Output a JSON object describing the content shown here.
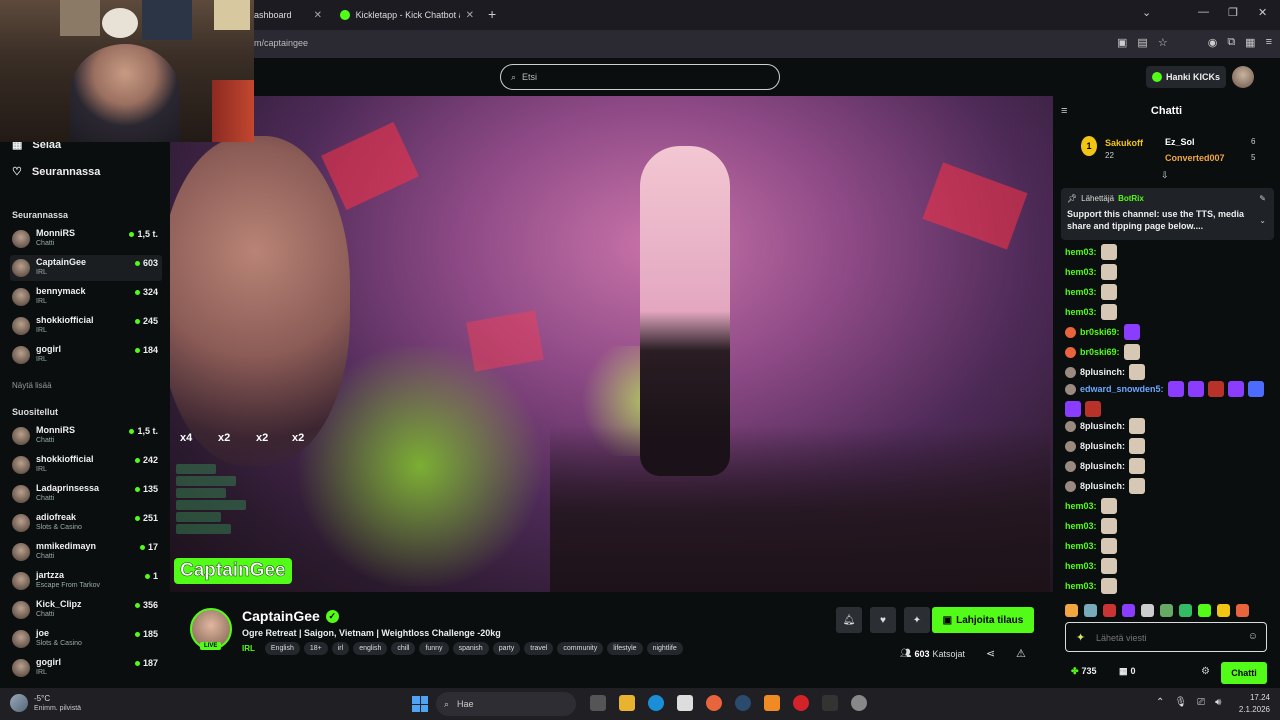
{
  "browser": {
    "tabs": [
      {
        "label": "ashboard"
      },
      {
        "label": "Kickletapp - Kick Chatbot and C"
      }
    ],
    "url": "m/captaingee"
  },
  "header": {
    "search_placeholder": "Etsi",
    "kicks_label": "Hanki KICKs"
  },
  "sidebar": {
    "nav": [
      {
        "label": "Selaa"
      },
      {
        "label": "Seurannassa"
      }
    ],
    "following_title": "Seurannassa",
    "following": [
      {
        "name": "MonniRS",
        "category": "Chatti",
        "viewers": "1,5 t."
      },
      {
        "name": "CaptainGee",
        "category": "IRL",
        "viewers": "603"
      },
      {
        "name": "bennymack",
        "category": "IRL",
        "viewers": "324"
      },
      {
        "name": "shokkiofficial",
        "category": "IRL",
        "viewers": "245"
      },
      {
        "name": "gogirl",
        "category": "IRL",
        "viewers": "184"
      }
    ],
    "show_less": "Näytä lisää",
    "recommended_title": "Suositellut",
    "recommended": [
      {
        "name": "MonniRS",
        "category": "Chatti",
        "viewers": "1,5 t."
      },
      {
        "name": "shokkiofficial",
        "category": "IRL",
        "viewers": "242"
      },
      {
        "name": "Ladaprinsessa",
        "category": "Chatti",
        "viewers": "135"
      },
      {
        "name": "adiofreak",
        "category": "Slots & Casino",
        "viewers": "251"
      },
      {
        "name": "mmikedimayn",
        "category": "Chatti",
        "viewers": "17"
      },
      {
        "name": "jartzza",
        "category": "Escape From Tarkov",
        "viewers": "1"
      },
      {
        "name": "Kick_Clipz",
        "category": "Chatti",
        "viewers": "356"
      },
      {
        "name": "joe",
        "category": "Slots & Casino",
        "viewers": "185"
      },
      {
        "name": "gogirl",
        "category": "IRL",
        "viewers": "187"
      }
    ]
  },
  "video": {
    "multipliers": [
      "x4",
      "x2",
      "x2",
      "x2"
    ],
    "watermark": "CaptainGee"
  },
  "stream": {
    "name": "CaptainGee",
    "live": "LIVE",
    "title": "Ogre Retreat | Saigon, Vietnam | Weightloss Challenge -20kg",
    "category": "IRL",
    "tags": [
      "English",
      "18+",
      "irl",
      "english",
      "chill",
      "funny",
      "spanish",
      "party",
      "travel",
      "community",
      "lifestyle",
      "nightlife"
    ],
    "subscribe_label": "Lahjoita tilaus",
    "viewers": "603",
    "viewers_label": "Katsojat"
  },
  "chat": {
    "title": "Chatti",
    "leaderboard": [
      {
        "rank": "1",
        "name": "Sakukoff",
        "count": "22"
      },
      {
        "name": "Ez_Sol",
        "count": "6"
      },
      {
        "name": "Converted007",
        "count": "5"
      }
    ],
    "pinned": {
      "sender_label": "Lähettäjä",
      "sender": "BotRix",
      "text": "Support this channel: use the TTS, media share and tipping page below...."
    },
    "messages": [
      {
        "user": "hem03:",
        "color": "#53fc18"
      },
      {
        "user": "hem03:",
        "color": "#53fc18"
      },
      {
        "user": "hem03:",
        "color": "#53fc18"
      },
      {
        "user": "hem03:",
        "color": "#53fc18"
      },
      {
        "user": "br0ski69:",
        "color": "#53fc18"
      },
      {
        "user": "br0ski69:",
        "color": "#53fc18"
      },
      {
        "user": "8plusinch:",
        "color": "#f0f0f0"
      },
      {
        "user": "edward_snowden5:",
        "color": "#6aa8ff"
      },
      {
        "user": "8plusinch:",
        "color": "#f0f0f0"
      },
      {
        "user": "8plusinch:",
        "color": "#f0f0f0"
      },
      {
        "user": "8plusinch:",
        "color": "#f0f0f0"
      },
      {
        "user": "8plusinch:",
        "color": "#f0f0f0"
      },
      {
        "user": "hem03:",
        "color": "#53fc18"
      },
      {
        "user": "hem03:",
        "color": "#53fc18"
      },
      {
        "user": "hem03:",
        "color": "#53fc18"
      },
      {
        "user": "hem03:",
        "color": "#53fc18"
      },
      {
        "user": "hem03:",
        "color": "#53fc18"
      }
    ],
    "input_placeholder": "Lähetä viesti",
    "points": "735",
    "points2": "0",
    "send_label": "Chatti"
  },
  "taskbar": {
    "temp": "-5°C",
    "weather": "Enimm. pilvistä",
    "search_label": "Hae",
    "time": "17.24",
    "date": "2.1.2026"
  },
  "colors": {
    "accent": "#53fc18",
    "background": "#0b0e0f",
    "chat_bg": "#0b0e0f"
  }
}
